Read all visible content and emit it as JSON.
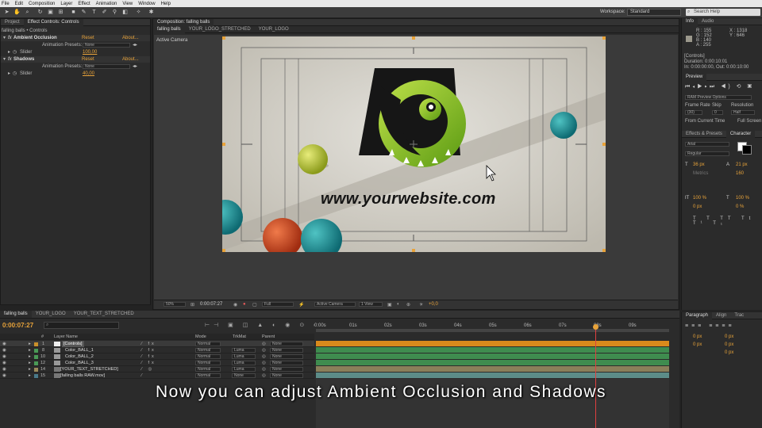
{
  "menu": [
    "File",
    "Edit",
    "Composition",
    "Layer",
    "Effect",
    "Animation",
    "View",
    "Window",
    "Help"
  ],
  "workspace": {
    "label": "Workspace:",
    "value": "Standard"
  },
  "search_placeholder": "Search Help",
  "left_panel": {
    "tabs": [
      "Project",
      "Effect Controls: Controls"
    ],
    "breadcrumb": "falling balls • Controls",
    "rows": [
      {
        "name": "Ambient Occlusion",
        "reset": "Reset",
        "about": "About..."
      },
      {
        "label": "Animation Presets:",
        "value": "None"
      },
      {
        "name": "Slider",
        "value": "100,00"
      },
      {
        "name": "Shadows",
        "reset": "Reset",
        "about": "About..."
      },
      {
        "label": "Animation Presets:",
        "value": "None"
      },
      {
        "name": "Slider",
        "value": "40,00"
      }
    ]
  },
  "comp_panel": {
    "title": "Composition: falling balls",
    "tabs": [
      "falling balls",
      "YOUR_LOGO_STRETCHED",
      "YOUR_LOGO"
    ],
    "active_camera": "Active Camera",
    "website": "www.yourwebsite.com",
    "toolbar": {
      "zoom": "50%",
      "time": "0:00:07:27",
      "res": "Full",
      "camera": "Active Camera",
      "view": "1 View",
      "exposure": "+0,0"
    }
  },
  "info_panel": {
    "tabs": [
      "Info",
      "Audio"
    ],
    "rgb": [
      "R : 155",
      "G : 152",
      "B : 140",
      "A : 255"
    ],
    "xy": [
      "X : 1318",
      "Y : 646"
    ],
    "layer": "[Controls]",
    "duration": "Duration: 0:00:10:01",
    "inout": "In: 0:00:00:00, Out: 0:00:10:00"
  },
  "preview_panel": {
    "title": "Preview",
    "ram": "RAM Preview Options",
    "labels": [
      "Frame Rate",
      "Skip",
      "Resolution"
    ],
    "values": [
      "(30)",
      "0",
      "Half"
    ],
    "from": "From Current Time",
    "full": "Full Screen"
  },
  "char_panel": {
    "tabs": [
      "Effects & Presets",
      "Character"
    ],
    "font": "Arial",
    "style": "Regular",
    "size": "36 px",
    "lead": "21 px",
    "track": "Metrics",
    "kern": "160",
    "vscale": "100 %",
    "hscale": "100 %",
    "baseline": "0 px",
    "tsume": "0 %"
  },
  "timeline": {
    "tabs": [
      "falling balls",
      "YOUR_LOGO",
      "YOUR_TEXT_STRETCHED"
    ],
    "current_time": "0:00:07:27",
    "ruler": [
      "0:00s",
      "01s",
      "02s",
      "03s",
      "04s",
      "05s",
      "06s",
      "07s",
      "08s",
      "09s"
    ],
    "headers": {
      "num": "#",
      "name": "Layer Name",
      "mode": "Mode",
      "trkmat": "TrkMat",
      "parent": "Parent"
    },
    "layers": [
      {
        "num": "1",
        "name": "[Controls]",
        "mode": "Normal",
        "trk": "",
        "parent": "None",
        "color": "#c9902b",
        "bar": "#d98a1c"
      },
      {
        "num": "8",
        "name": "Color_BALL_1",
        "mode": "Normal",
        "trk": "Luma",
        "parent": "None",
        "color": "#4a9a56",
        "bar": "#3f8c4f"
      },
      {
        "num": "10",
        "name": "Color_BALL_2",
        "mode": "Normal",
        "trk": "Luma",
        "parent": "None",
        "color": "#4a9a56",
        "bar": "#3f8c4f"
      },
      {
        "num": "12",
        "name": "Color_BALL_3",
        "mode": "Normal",
        "trk": "Luma",
        "parent": "None",
        "color": "#4a9a56",
        "bar": "#3f8c4f"
      },
      {
        "num": "14",
        "name": "[YOUR_TEXT_STRETCHED]",
        "mode": "Normal",
        "trk": "Luma",
        "parent": "None",
        "color": "#9c8a5a",
        "bar": "#8a7f5a"
      },
      {
        "num": "15",
        "name": "[falling balls RAW.mov]",
        "mode": "Normal",
        "trk": "None",
        "parent": "None",
        "color": "#4a7a8a",
        "bar": "#5c8c88"
      }
    ]
  },
  "paragraph_panel": {
    "tabs": [
      "Paragraph",
      "Align",
      "Trac"
    ],
    "values": [
      "0 px",
      "0 px",
      "0 px",
      "0 px",
      "0 px"
    ]
  },
  "caption": "Now you can adjust Ambient Occlusion and Shadows"
}
